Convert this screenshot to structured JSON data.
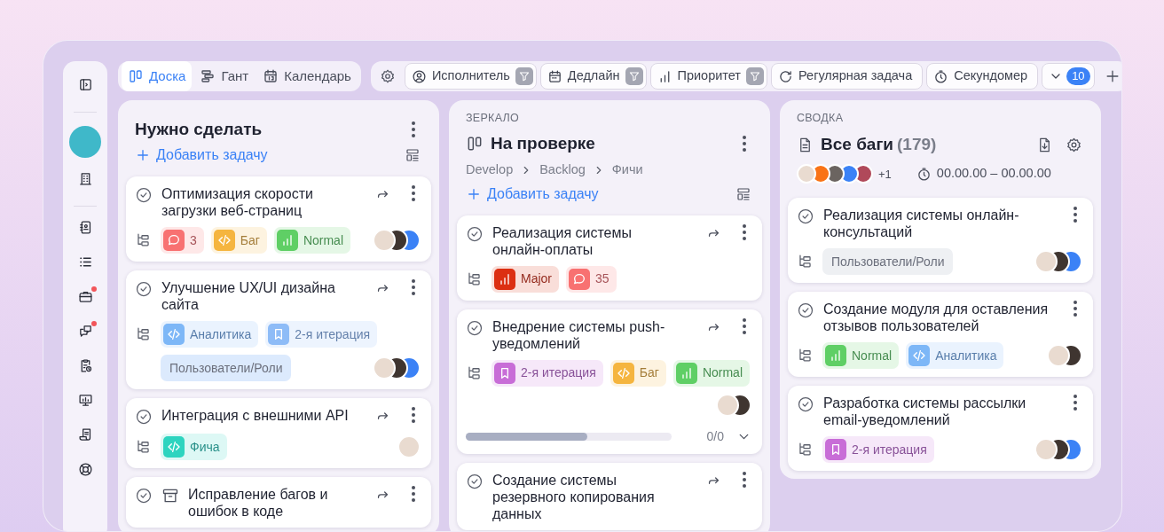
{
  "sidebar": {
    "items": [
      {
        "kind": "panel",
        "badge": false
      },
      {
        "kind": "divider"
      },
      {
        "kind": "avatar",
        "color": "#3fb8c9"
      },
      {
        "kind": "building",
        "badge": false
      },
      {
        "kind": "divider"
      },
      {
        "kind": "contacts",
        "badge": false
      },
      {
        "kind": "list",
        "badge": false
      },
      {
        "kind": "briefcase",
        "badge": true
      },
      {
        "kind": "chat",
        "badge": true
      },
      {
        "kind": "clipboard",
        "badge": false
      },
      {
        "kind": "monitor",
        "badge": false
      },
      {
        "kind": "scroll",
        "badge": false
      },
      {
        "kind": "lifebuoy",
        "badge": false
      }
    ]
  },
  "view_tabs": [
    {
      "kind": "board",
      "label": "Доска",
      "selected": true
    },
    {
      "kind": "gantt",
      "label": "Гант",
      "selected": false
    },
    {
      "kind": "calendar",
      "label": "Календарь",
      "selected": false
    }
  ],
  "toolbar": {
    "filters": [
      {
        "kind": "assignee",
        "label": "Исполнитель",
        "filtered": true
      },
      {
        "kind": "deadline",
        "label": "Дедлайн",
        "filtered": true
      },
      {
        "kind": "priority",
        "label": "Приоритет",
        "filtered": true
      },
      {
        "kind": "recurring",
        "label": "Регулярная задача",
        "filtered": false
      },
      {
        "kind": "stopwatch",
        "label": "Секундомер",
        "filtered": false
      }
    ],
    "more_count": "10"
  },
  "columns": [
    {
      "title": "Нужно сделать",
      "add_label": "Добавить задачу",
      "cards": [
        {
          "title": "Оптимизация скорости загрузки веб-страниц",
          "archived": false,
          "forward": true,
          "tags": [
            {
              "kind": "comment",
              "label": "3",
              "color": "#f87171"
            },
            {
              "kind": "code",
              "label": "Баг",
              "color": "#f5b53f"
            },
            {
              "kind": "priority",
              "label": "Normal",
              "color": "#5fcf65"
            }
          ],
          "avatars": [
            {
              "color": "#e9dbd0"
            },
            {
              "color": "#3f3530"
            },
            {
              "color": "#3b82f6"
            }
          ]
        },
        {
          "title": "Улучшение UX/UI дизайна сайта",
          "archived": false,
          "forward": true,
          "tags": [
            {
              "kind": "code",
              "label": "Аналитика",
              "color": "#7db7f7"
            },
            {
              "kind": "bookmark",
              "label": "2-я итерация",
              "color": "#8ebcf7"
            },
            {
              "kind": "plain",
              "label": "Пользователи/Роли",
              "color": "#dceafd"
            }
          ],
          "avatars": [
            {
              "color": "#e9dbd0"
            },
            {
              "color": "#3f3530"
            },
            {
              "color": "#3b82f6"
            }
          ]
        },
        {
          "title": "Интеграция с внешними API",
          "archived": false,
          "forward": true,
          "tags": [
            {
              "kind": "code",
              "label": "Фича",
              "color": "#2dd4bf"
            }
          ],
          "avatars": [
            {
              "color": "#e9dbd0"
            }
          ]
        },
        {
          "title": "Исправление багов и ошибок в коде",
          "archived": true,
          "forward": true
        }
      ]
    },
    {
      "caption": "ЗЕРКАЛО",
      "title": "На проверке",
      "breadcrumbs": [
        "Develop",
        "Backlog",
        "Фичи"
      ],
      "add_label": "Добавить задачу",
      "cards": [
        {
          "title": "Реализация системы онлайн-оплаты",
          "archived": false,
          "forward": true,
          "tags": [
            {
              "kind": "priority",
              "label": "Major",
              "color": "#dc2f12"
            },
            {
              "kind": "comment",
              "label": "35",
              "color": "#f87171"
            }
          ]
        },
        {
          "title": "Внедрение системы push-уведомлений",
          "archived": false,
          "forward": true,
          "tags": [
            {
              "kind": "bookmark",
              "label": "2-я итерация",
              "color": "#c86dd7"
            },
            {
              "kind": "code",
              "label": "Баг",
              "color": "#f5b53f"
            },
            {
              "kind": "priority",
              "label": "Normal",
              "color": "#5fcf65"
            }
          ],
          "avatars": [
            {
              "color": "#e9dbd0"
            },
            {
              "color": "#3f3530"
            }
          ],
          "progress": {
            "level": 0.59,
            "reading": "0/0"
          }
        },
        {
          "title": "Создание системы резервного копирования данных",
          "archived": false,
          "forward": true
        }
      ]
    },
    {
      "caption": "СВОДКА",
      "title": "Все баги",
      "count": "(179)",
      "members": [
        {
          "color": "#e9dbd0"
        },
        {
          "color": "#f97316"
        },
        {
          "color": "#6b6460"
        },
        {
          "color": "#3b82f6"
        },
        {
          "color": "#b0495a"
        }
      ],
      "members_more": "+1",
      "timer": "00.00.00 – 00.00.00",
      "cards": [
        {
          "title": "Реализация системы онлайн-консультаций",
          "archived": false,
          "forward": false,
          "tags": [
            {
              "kind": "plain",
              "label": "Пользователи/Роли",
              "color": "#eef0f3"
            }
          ],
          "avatars": [
            {
              "color": "#e9dbd0"
            },
            {
              "color": "#3f3530"
            },
            {
              "color": "#3b82f6"
            }
          ]
        },
        {
          "title": "Создание модуля для оставления отзывов пользователей",
          "archived": false,
          "forward": false,
          "tags": [
            {
              "kind": "priority",
              "label": "Normal",
              "color": "#5fcf65"
            },
            {
              "kind": "code",
              "label": "Аналитика",
              "color": "#7db7f7"
            }
          ],
          "avatars": [
            {
              "color": "#e9dbd0"
            },
            {
              "color": "#3f3530"
            }
          ]
        },
        {
          "title": "Разработка системы рассылки email-уведомлений",
          "archived": false,
          "forward": false,
          "tags": [
            {
              "kind": "bookmark",
              "label": "2-я итерация",
              "color": "#c86dd7"
            }
          ],
          "avatars": [
            {
              "color": "#e9dbd0"
            },
            {
              "color": "#3f3530"
            },
            {
              "color": "#3b82f6"
            }
          ]
        }
      ]
    }
  ]
}
